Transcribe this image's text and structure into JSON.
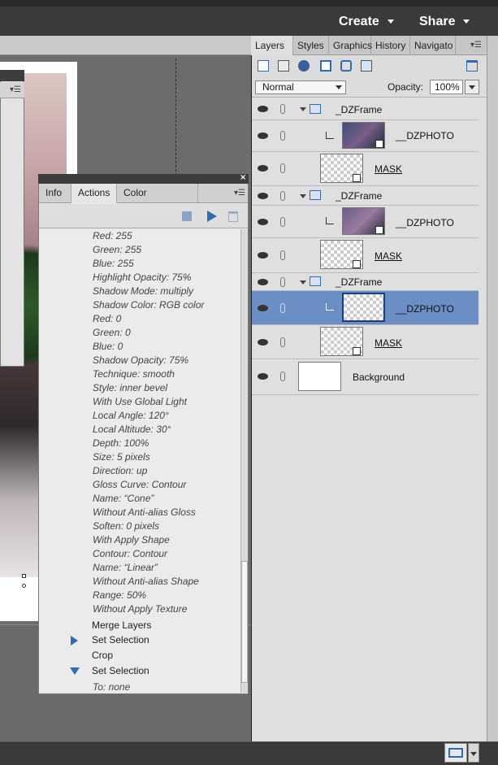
{
  "topbar": {
    "create_label": "Create",
    "share_label": "Share"
  },
  "actions_panel": {
    "tabs": [
      "Info",
      "Actions",
      "Color Swatches"
    ],
    "items": [
      "Red: 255",
      "Green: 255",
      "Blue: 255",
      "Highlight Opacity: 75%",
      "Shadow Mode: multiply",
      "Shadow Color: RGB color",
      "Red: 0",
      "Green: 0",
      "Blue: 0",
      "Shadow Opacity: 75%",
      "Technique: smooth",
      "Style: inner bevel",
      "With Use Global Light",
      "Local Angle: 120°",
      "Local Altitude: 30°",
      "Depth: 100%",
      "Size: 5 pixels",
      "Direction: up",
      "Gloss Curve: Contour",
      "Name: “Cone”",
      "Without Anti-alias Gloss",
      "Soften: 0 pixels",
      "With Apply Shape",
      "Contour: Contour",
      "Name: “Linear”",
      "Without Anti-alias Shape",
      "Range: 50%",
      "Without Apply Texture"
    ],
    "commands": [
      "Merge Layers",
      "Set Selection",
      "Crop",
      "Set Selection"
    ],
    "last_item": "To: none"
  },
  "layers_panel": {
    "tabs": [
      "Layers",
      "Styles",
      "Graphics",
      "History",
      "Navigato"
    ],
    "blend_mode": "Normal",
    "opacity_label": "Opacity:",
    "opacity_value": "100%",
    "layers": [
      {
        "name": "_DZFrame"
      },
      {
        "name": "__DZPHOTO"
      },
      {
        "name": "MASK"
      },
      {
        "name": "_DZFrame"
      },
      {
        "name": "__DZPHOTO"
      },
      {
        "name": "MASK"
      },
      {
        "name": "_DZFrame"
      },
      {
        "name": "__DZPHOTO"
      },
      {
        "name": "MASK"
      },
      {
        "name": "Background"
      }
    ]
  },
  "colors": {
    "accent": "#2f6cb3",
    "selected_row": "#6b8fc4"
  }
}
